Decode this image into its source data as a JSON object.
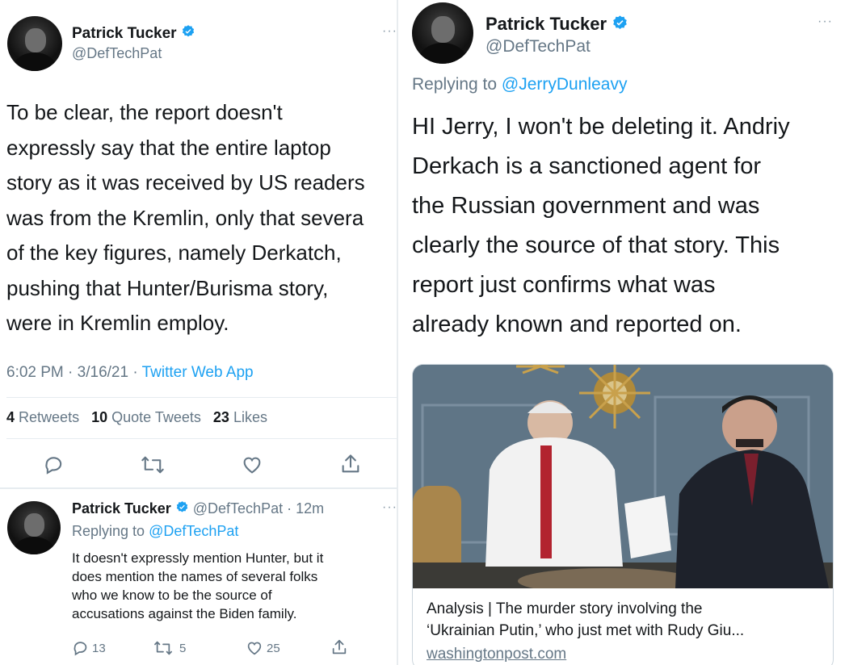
{
  "left_tweet": {
    "author_name": "Patrick Tucker",
    "author_handle": "@DefTechPat",
    "more": "···",
    "text_lines": [
      "To be clear, the report doesn't",
      "expressly say that the entire laptop",
      "story as it was received by US readers",
      "was from the Kremlin, only that severa",
      "of the key figures, namely Derkatch,",
      "pushing that Hunter/Burisma story,",
      "were in Kremlin employ."
    ],
    "time": "6:02 PM",
    "date": "3/16/21",
    "source": "Twitter Web App",
    "retweets_count": "4",
    "retweets_label": "Retweets",
    "quotes_count": "10",
    "quotes_label": "Quote Tweets",
    "likes_count": "23",
    "likes_label": "Likes"
  },
  "left_reply": {
    "author_name": "Patrick Tucker",
    "author_handle": "@DefTechPat",
    "age": "12m",
    "replying_label": "Replying to",
    "replying_to": "@DefTechPat",
    "more": "···",
    "text_lines": [
      "It doesn't expressly mention Hunter, but it",
      "does mention the names of several folks",
      "who we know to be the source of",
      "accusations against the Biden family."
    ],
    "reply_count": "13",
    "retweet_count": "5",
    "like_count": "25"
  },
  "right_tweet": {
    "author_name": "Patrick Tucker",
    "author_handle": "@DefTechPat",
    "more": "···",
    "replying_label": "Replying to",
    "replying_to": "@JerryDunleavy",
    "text_lines": [
      "HI Jerry, I won't be deleting it. Andriy",
      "Derkach is a sanctioned agent for",
      "the Russian government and was",
      "clearly the source of that story. This",
      "report just confirms what was",
      "already known and reported on."
    ],
    "card": {
      "title_line1": "Analysis | The murder story involving the",
      "title_line2": "‘Ukrainian Putin,’ who just met with Rudy Giu...",
      "domain": "washingtonpost.com"
    }
  },
  "colors": {
    "accent": "#1da1f2",
    "text": "#14171a",
    "muted": "#657786",
    "border": "#e6ecf0"
  },
  "icons": [
    "verified-badge-icon",
    "more-icon",
    "reply-icon",
    "retweet-icon",
    "like-icon",
    "share-icon"
  ]
}
